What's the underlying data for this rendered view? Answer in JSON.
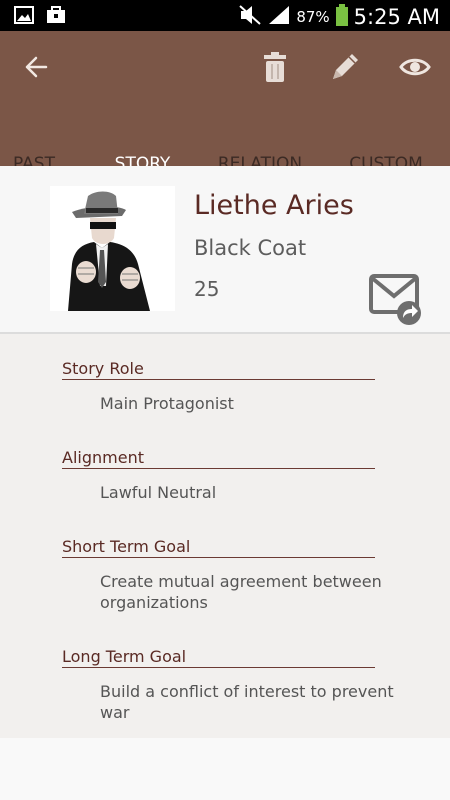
{
  "status_bar": {
    "battery_percent": "87%",
    "time": "5:25 AM",
    "icons": [
      "image-icon",
      "briefcase-icon",
      "mute-icon",
      "signal-icon",
      "battery-icon"
    ]
  },
  "action_bar": {
    "background": "#7b5647",
    "icons": [
      "back-arrow-icon",
      "trash-icon",
      "pencil-icon",
      "eye-icon"
    ]
  },
  "tabs": [
    {
      "label": "PAST",
      "active": false
    },
    {
      "label": "STORY",
      "active": true
    },
    {
      "label": "RELATION",
      "active": false
    },
    {
      "label": "CUSTOM",
      "active": false
    }
  ],
  "profile": {
    "name": "Liethe Aries",
    "subtitle": "Black Coat",
    "age": "25"
  },
  "fields": [
    {
      "label": "Story Role",
      "value": "Main Protagonist"
    },
    {
      "label": "Alignment",
      "value": "Lawful Neutral"
    },
    {
      "label": "Short Term Goal",
      "value": "Create mutual agreement between organizations"
    },
    {
      "label": "Long Term Goal",
      "value": "Build a conflict of interest to prevent war"
    }
  ]
}
